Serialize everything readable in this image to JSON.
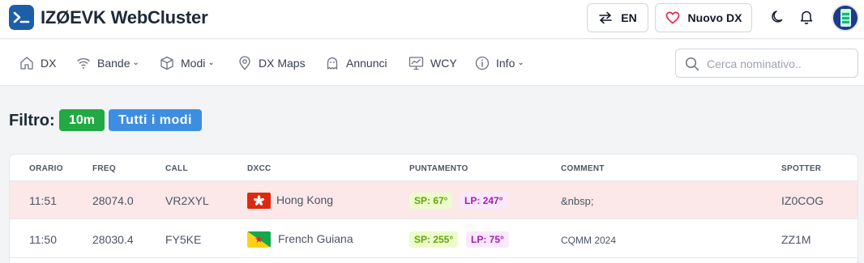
{
  "header": {
    "brand": "IZØEVK WebCluster",
    "lang_label": "EN",
    "new_dx_label": "Nuovo DX"
  },
  "nav": {
    "items": [
      {
        "label": "DX",
        "icon": "home-icon"
      },
      {
        "label": "Bande",
        "icon": "wifi-icon",
        "dropdown": true
      },
      {
        "label": "Modi",
        "icon": "cube-icon",
        "dropdown": true
      },
      {
        "label": "DX Maps",
        "icon": "map-pin-icon"
      },
      {
        "label": "Annunci",
        "icon": "ghost-icon"
      },
      {
        "label": "WCY",
        "icon": "monitor-chart-icon"
      },
      {
        "label": "Info",
        "icon": "info-icon",
        "dropdown": true
      }
    ],
    "search_placeholder": "Cerca nominativo.."
  },
  "filter": {
    "label": "Filtro:",
    "band": "10m",
    "mode": "Tutti i modi"
  },
  "table": {
    "columns": [
      "ORARIO",
      "FREQ",
      "CALL",
      "DXCC",
      "PUNTAMENTO",
      "COMMENT",
      "SPOTTER"
    ],
    "rows": [
      {
        "time": "11:51",
        "freq": "28074.0",
        "call": "VR2XYL",
        "dxcc": "Hong Kong",
        "flag": "hong-kong-flag",
        "sp": "SP: 67°",
        "lp": "LP: 247°",
        "comment": "&nbsp;",
        "spotter": "IZ0COG",
        "highlight": true
      },
      {
        "time": "11:50",
        "freq": "28030.4",
        "call": "FY5KE",
        "dxcc": "French Guiana",
        "flag": "french-guiana-flag",
        "sp": "SP: 255°",
        "lp": "LP: 75°",
        "comment": "CQMM 2024",
        "spotter": "ZZ1M",
        "highlight": false
      }
    ]
  },
  "colors": {
    "brand_blue": "#1d5ea8",
    "band_badge": "#22a943",
    "mode_badge": "#3d8ee0",
    "highlight_row": "#fce8e8",
    "sp_text": "#65a30d",
    "lp_text": "#a21caf"
  }
}
